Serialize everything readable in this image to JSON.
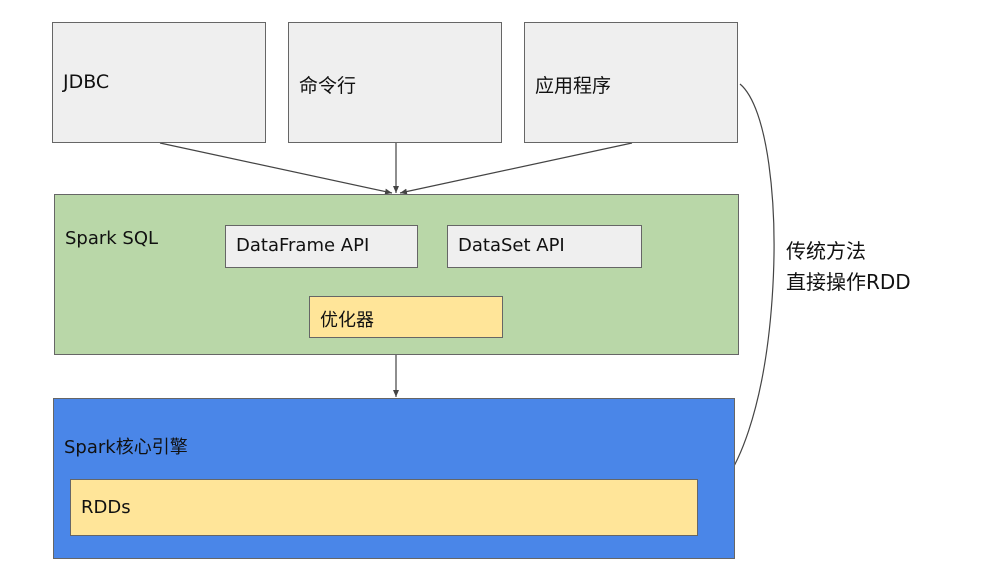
{
  "clients": [
    {
      "label": "JDBC"
    },
    {
      "label": "命令行"
    },
    {
      "label": "应用程序"
    }
  ],
  "spark_sql": {
    "title": "Spark SQL",
    "dataframe_api": "DataFrame API",
    "dataset_api": "DataSet API",
    "optimizer": "优化器"
  },
  "spark_core": {
    "title": "Spark核心引擎",
    "rdds": "RDDs"
  },
  "side_note": {
    "line1": "传统方法",
    "line2": "直接操作RDD"
  },
  "colors": {
    "client_fill": "#efefef",
    "spark_sql_fill": "#b9d7a8",
    "spark_core_fill": "#4a86e8",
    "highlight_fill": "#ffe599",
    "border": "#666666",
    "connector": "#444444"
  }
}
